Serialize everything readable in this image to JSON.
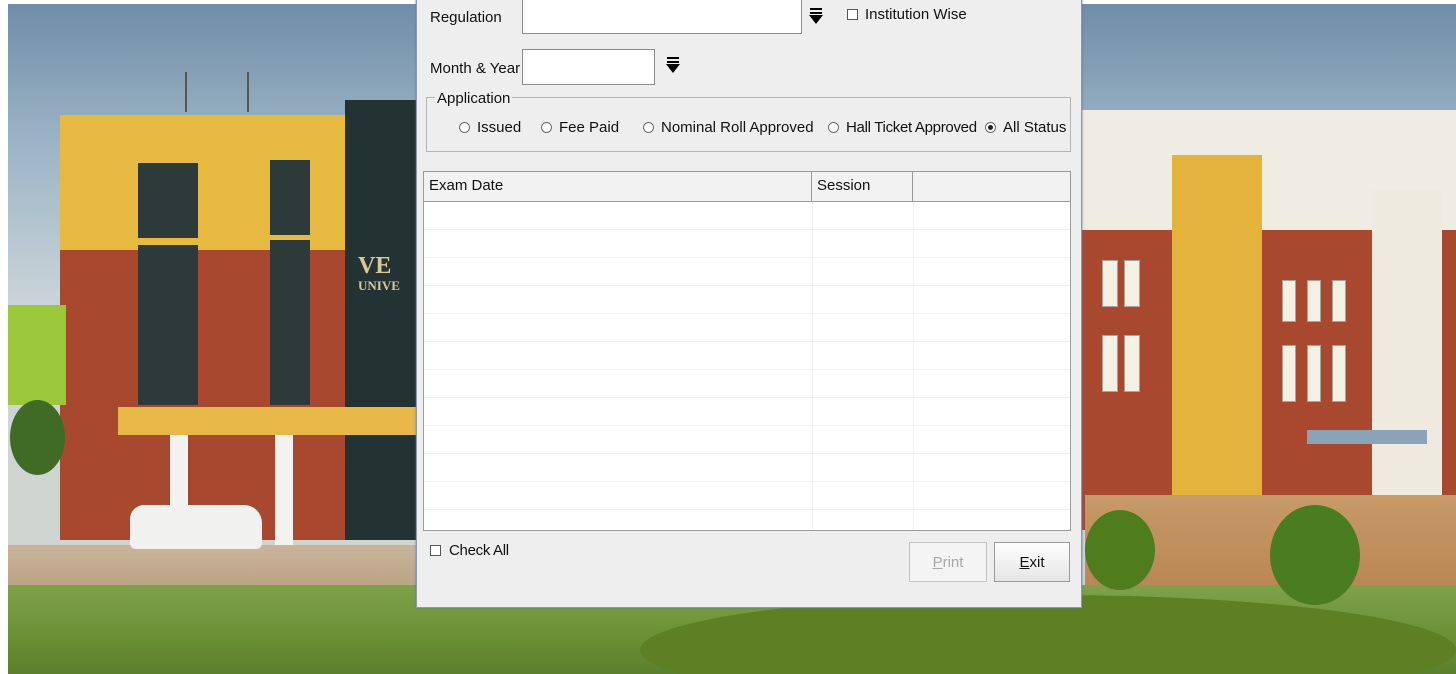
{
  "dialog": {
    "regulation_label": "Regulation",
    "regulation_value": "",
    "institution_wise_label": "Institution Wise",
    "institution_wise_checked": false,
    "month_year_label": "Month & Year",
    "month_year_value": "",
    "application_group_title": "Application",
    "application_options": [
      {
        "label": "Issued",
        "selected": false
      },
      {
        "label": "Fee Paid",
        "selected": false
      },
      {
        "label": "Nominal Roll Approved",
        "selected": false
      },
      {
        "label": "Hall Ticket Approved",
        "selected": false
      },
      {
        "label": "All Status",
        "selected": true
      }
    ],
    "table": {
      "columns": [
        "Exam Date",
        "Session",
        ""
      ],
      "rows": []
    },
    "check_all_label": "Check All",
    "check_all_checked": false,
    "print_button": {
      "mnemonic": "P",
      "rest": "rint",
      "enabled": false
    },
    "exit_button": {
      "mnemonic": "E",
      "rest": "xit",
      "enabled": true
    }
  },
  "background": {
    "sign_text_line1": "VE",
    "sign_text_line2": "UNIVE"
  },
  "colors": {
    "dialog_bg": "#eeeeee",
    "brick": "#a8492f",
    "yellow_wall": "#e8b93a"
  }
}
